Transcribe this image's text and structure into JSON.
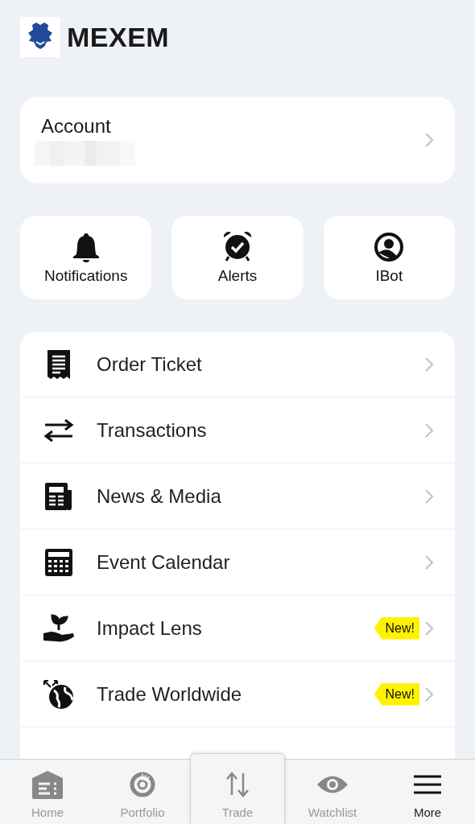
{
  "brand": {
    "name": "MEXEM"
  },
  "account": {
    "title": "Account"
  },
  "shortcuts": [
    {
      "label": "Notifications"
    },
    {
      "label": "Alerts"
    },
    {
      "label": "IBot"
    }
  ],
  "menu": [
    {
      "label": "Order Ticket"
    },
    {
      "label": "Transactions"
    },
    {
      "label": "News & Media"
    },
    {
      "label": "Event Calendar"
    },
    {
      "label": "Impact Lens",
      "badge": "New!"
    },
    {
      "label": "Trade Worldwide",
      "badge": "New!"
    }
  ],
  "tab_bar": [
    {
      "label": "Home",
      "selected": false
    },
    {
      "label": "Portfolio",
      "selected": false
    },
    {
      "label": "Trade",
      "selected": false
    },
    {
      "label": "Watchlist",
      "selected": false
    },
    {
      "label": "More",
      "selected": true
    }
  ]
}
